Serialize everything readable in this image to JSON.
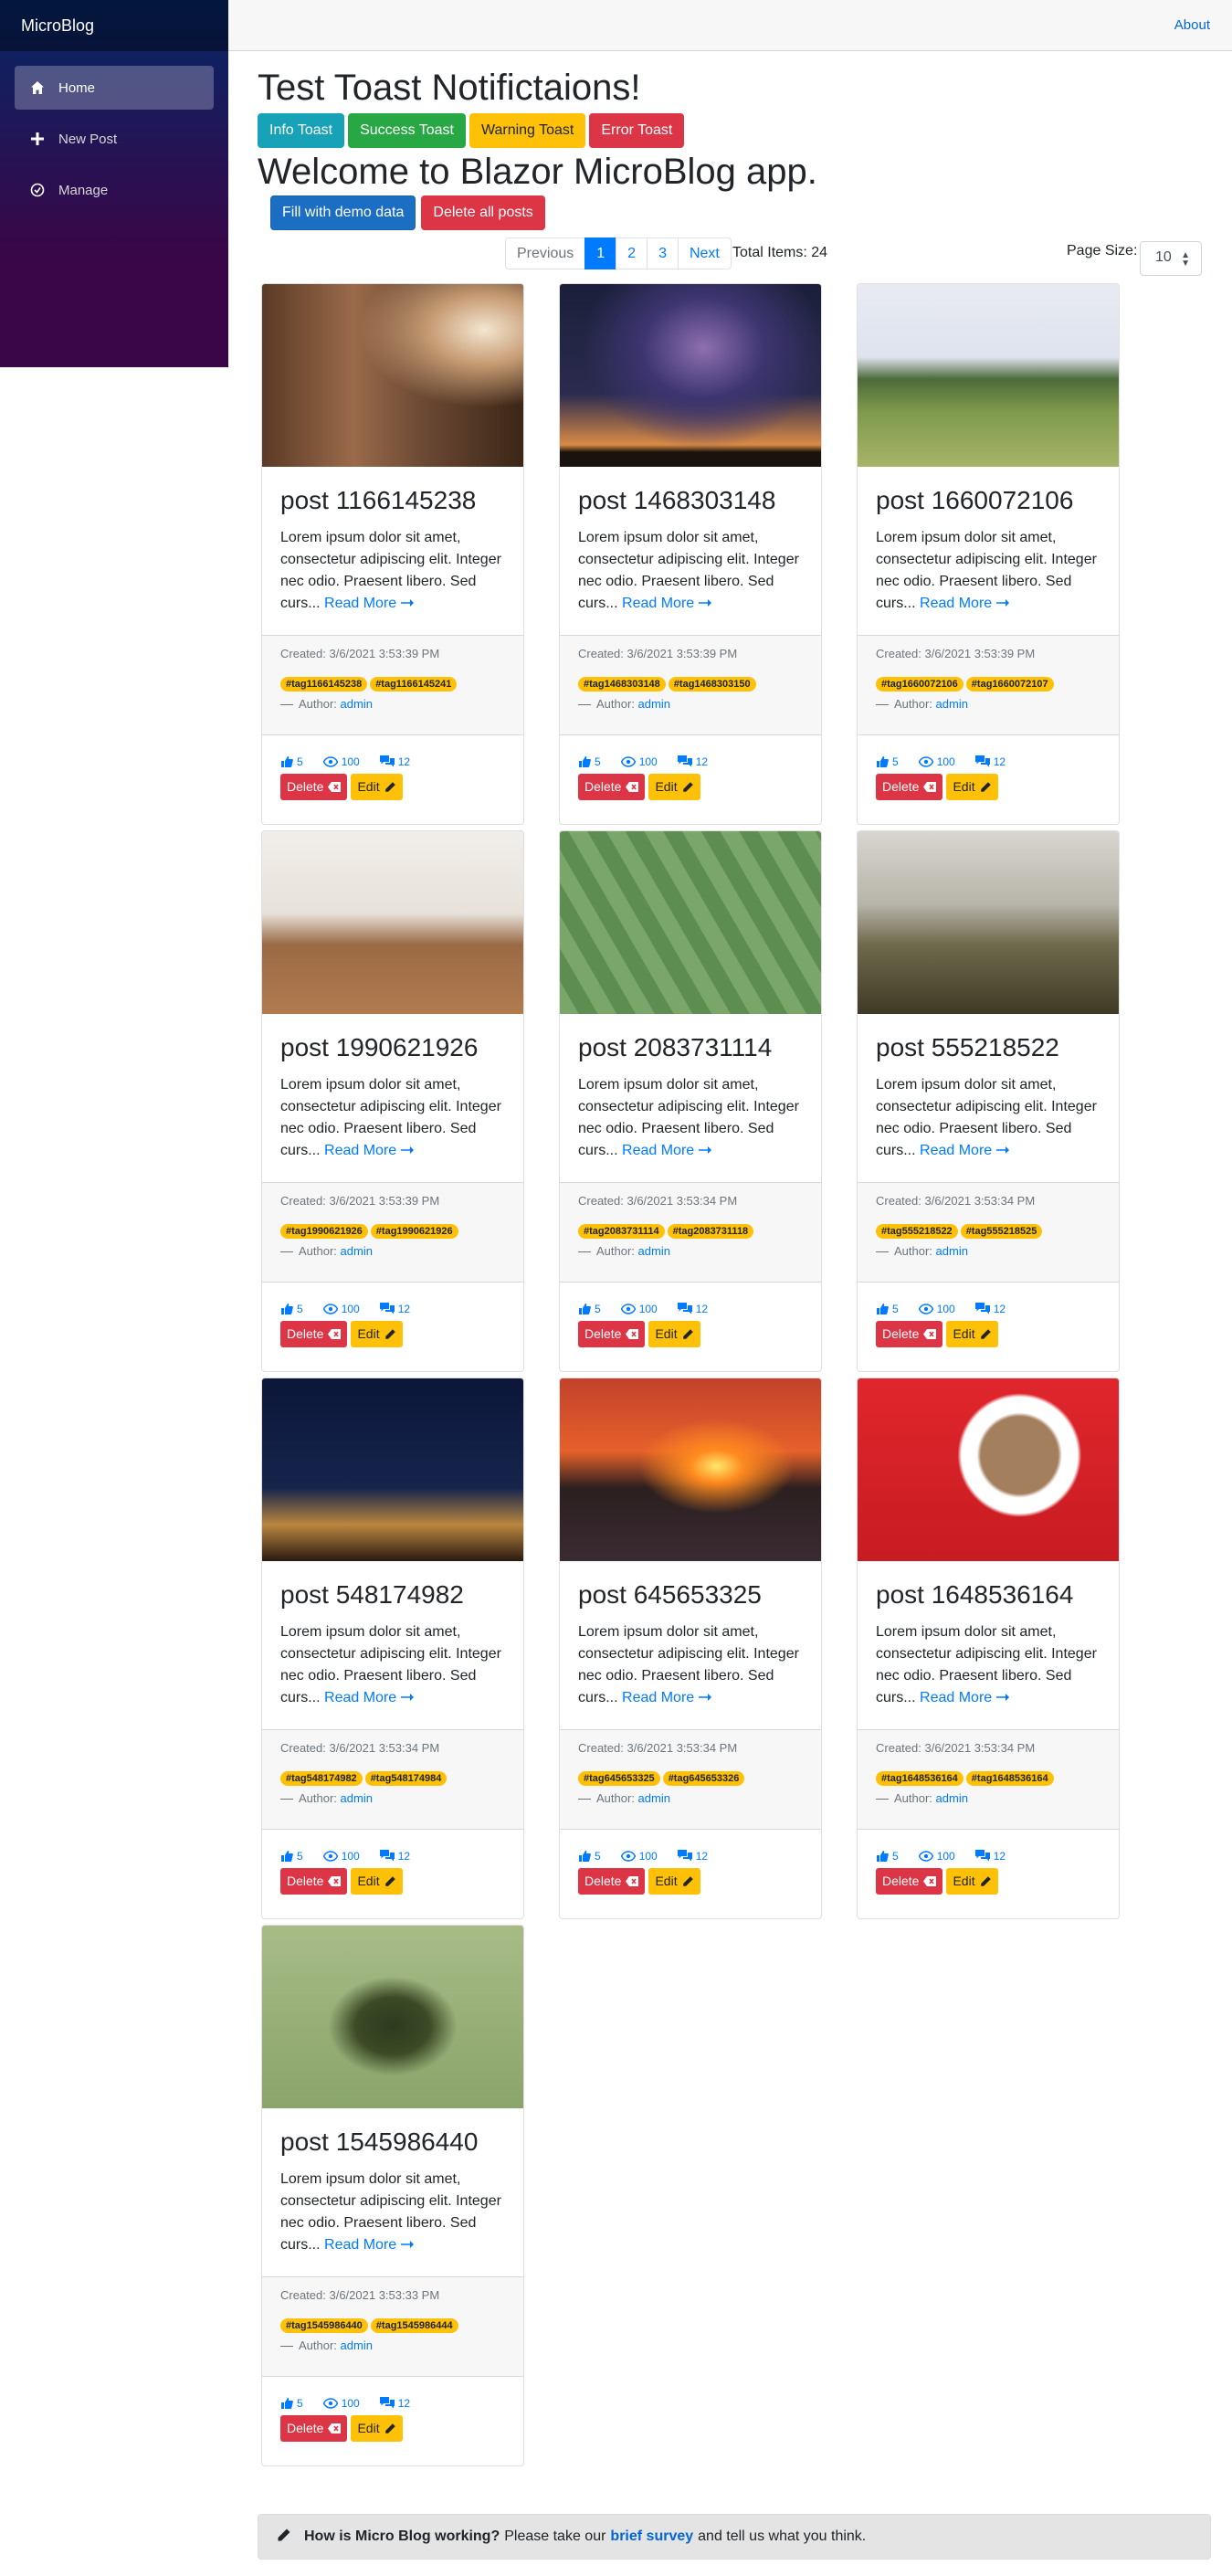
{
  "app": {
    "brand": "MicroBlog"
  },
  "sidebar": {
    "items": [
      {
        "label": "Home",
        "icon": "home-icon",
        "active": true
      },
      {
        "label": "New Post",
        "icon": "plus-icon",
        "active": false
      },
      {
        "label": "Manage",
        "icon": "manage-icon",
        "active": false
      }
    ]
  },
  "header": {
    "about": "About"
  },
  "toast": {
    "title": "Test Toast Notifictaions!",
    "info": "Info Toast",
    "success": "Success Toast",
    "warning": "Warning Toast",
    "error": "Error Toast"
  },
  "welcome": {
    "title": "Welcome to Blazor MicroBlog app.",
    "fill": "Fill with demo data",
    "delete_all": "Delete all posts"
  },
  "pager": {
    "previous": "Previous",
    "pages": [
      "1",
      "2",
      "3"
    ],
    "current": "1",
    "next": "Next",
    "total": "Total Items: 24",
    "page_size_label": "Page Size:",
    "page_size": "10"
  },
  "card_labels": {
    "read_more": "Read More",
    "author_prefix": "Author:",
    "delete": "Delete",
    "edit": "Edit"
  },
  "posts": [
    {
      "title": "post 1166145238",
      "text": "Lorem ipsum dolor sit amet, consectetur adipiscing elit. Integer nec odio. Praesent libero. Sed curs...",
      "created": "Created: 3/6/2021 3:53:39 PM",
      "tags": [
        "#tag1166145238",
        "#tag1166145241"
      ],
      "author": "admin",
      "likes": "5",
      "views": "100",
      "comments": "12",
      "image": "person-by-window"
    },
    {
      "title": "post 1468303148",
      "text": "Lorem ipsum dolor sit amet, consectetur adipiscing elit. Integer nec odio. Praesent libero. Sed curs...",
      "created": "Created: 3/6/2021 3:53:39 PM",
      "tags": [
        "#tag1468303148",
        "#tag1468303150"
      ],
      "author": "admin",
      "likes": "5",
      "views": "100",
      "comments": "12",
      "image": "milky-way"
    },
    {
      "title": "post 1660072106",
      "text": "Lorem ipsum dolor sit amet, consectetur adipiscing elit. Integer nec odio. Praesent libero. Sed curs...",
      "created": "Created: 3/6/2021 3:53:39 PM",
      "tags": [
        "#tag1660072106",
        "#tag1660072107"
      ],
      "author": "admin",
      "likes": "5",
      "views": "100",
      "comments": "12",
      "image": "green-hills"
    },
    {
      "title": "post 1990621926",
      "text": "Lorem ipsum dolor sit amet, consectetur adipiscing elit. Integer nec odio. Praesent libero. Sed curs...",
      "created": "Created: 3/6/2021 3:53:39 PM",
      "tags": [
        "#tag1990621926",
        "#tag1990621926"
      ],
      "author": "admin",
      "likes": "5",
      "views": "100",
      "comments": "12",
      "image": "dining-room"
    },
    {
      "title": "post 2083731114",
      "text": "Lorem ipsum dolor sit amet, consectetur adipiscing elit. Integer nec odio. Praesent libero. Sed curs...",
      "created": "Created: 3/6/2021 3:53:34 PM",
      "tags": [
        "#tag2083731114",
        "#tag2083731118"
      ],
      "author": "admin",
      "likes": "5",
      "views": "100",
      "comments": "12",
      "image": "stadium"
    },
    {
      "title": "post 555218522",
      "text": "Lorem ipsum dolor sit amet, consectetur adipiscing elit. Integer nec odio. Praesent libero. Sed curs...",
      "created": "Created: 3/6/2021 3:53:34 PM",
      "tags": [
        "#tag555218522",
        "#tag555218525"
      ],
      "author": "admin",
      "likes": "5",
      "views": "100",
      "comments": "12",
      "image": "valley"
    },
    {
      "title": "post 548174982",
      "text": "Lorem ipsum dolor sit amet, consectetur adipiscing elit. Integer nec odio. Praesent libero. Sed curs...",
      "created": "Created: 3/6/2021 3:53:34 PM",
      "tags": [
        "#tag548174982",
        "#tag548174984"
      ],
      "author": "admin",
      "likes": "5",
      "views": "100",
      "comments": "12",
      "image": "night-mountains"
    },
    {
      "title": "post 645653325",
      "text": "Lorem ipsum dolor sit amet, consectetur adipiscing elit. Integer nec odio. Praesent libero. Sed curs...",
      "created": "Created: 3/6/2021 3:53:34 PM",
      "tags": [
        "#tag645653325",
        "#tag645653326"
      ],
      "author": "admin",
      "likes": "5",
      "views": "100",
      "comments": "12",
      "image": "sunset-sea"
    },
    {
      "title": "post 1648536164",
      "text": "Lorem ipsum dolor sit amet, consectetur adipiscing elit. Integer nec odio. Praesent libero. Sed curs...",
      "created": "Created: 3/6/2021 3:53:34 PM",
      "tags": [
        "#tag1648536164",
        "#tag1648536164"
      ],
      "author": "admin",
      "likes": "5",
      "views": "100",
      "comments": "12",
      "image": "coffee-cup"
    },
    {
      "title": "post 1545986440",
      "text": "Lorem ipsum dolor sit amet, consectetur adipiscing elit. Integer nec odio. Praesent libero. Sed curs...",
      "created": "Created: 3/6/2021 3:53:33 PM",
      "tags": [
        "#tag1545986440",
        "#tag1545986444"
      ],
      "author": "admin",
      "likes": "5",
      "views": "100",
      "comments": "12",
      "image": "alligator"
    }
  ],
  "survey": {
    "question": "How is Micro Blog working?",
    "text1": "Please take our",
    "link": "brief survey",
    "text2": "and tell us what you think."
  },
  "colors": {
    "primary": "#007bff",
    "warning": "#ffc107",
    "danger": "#dc3545"
  }
}
